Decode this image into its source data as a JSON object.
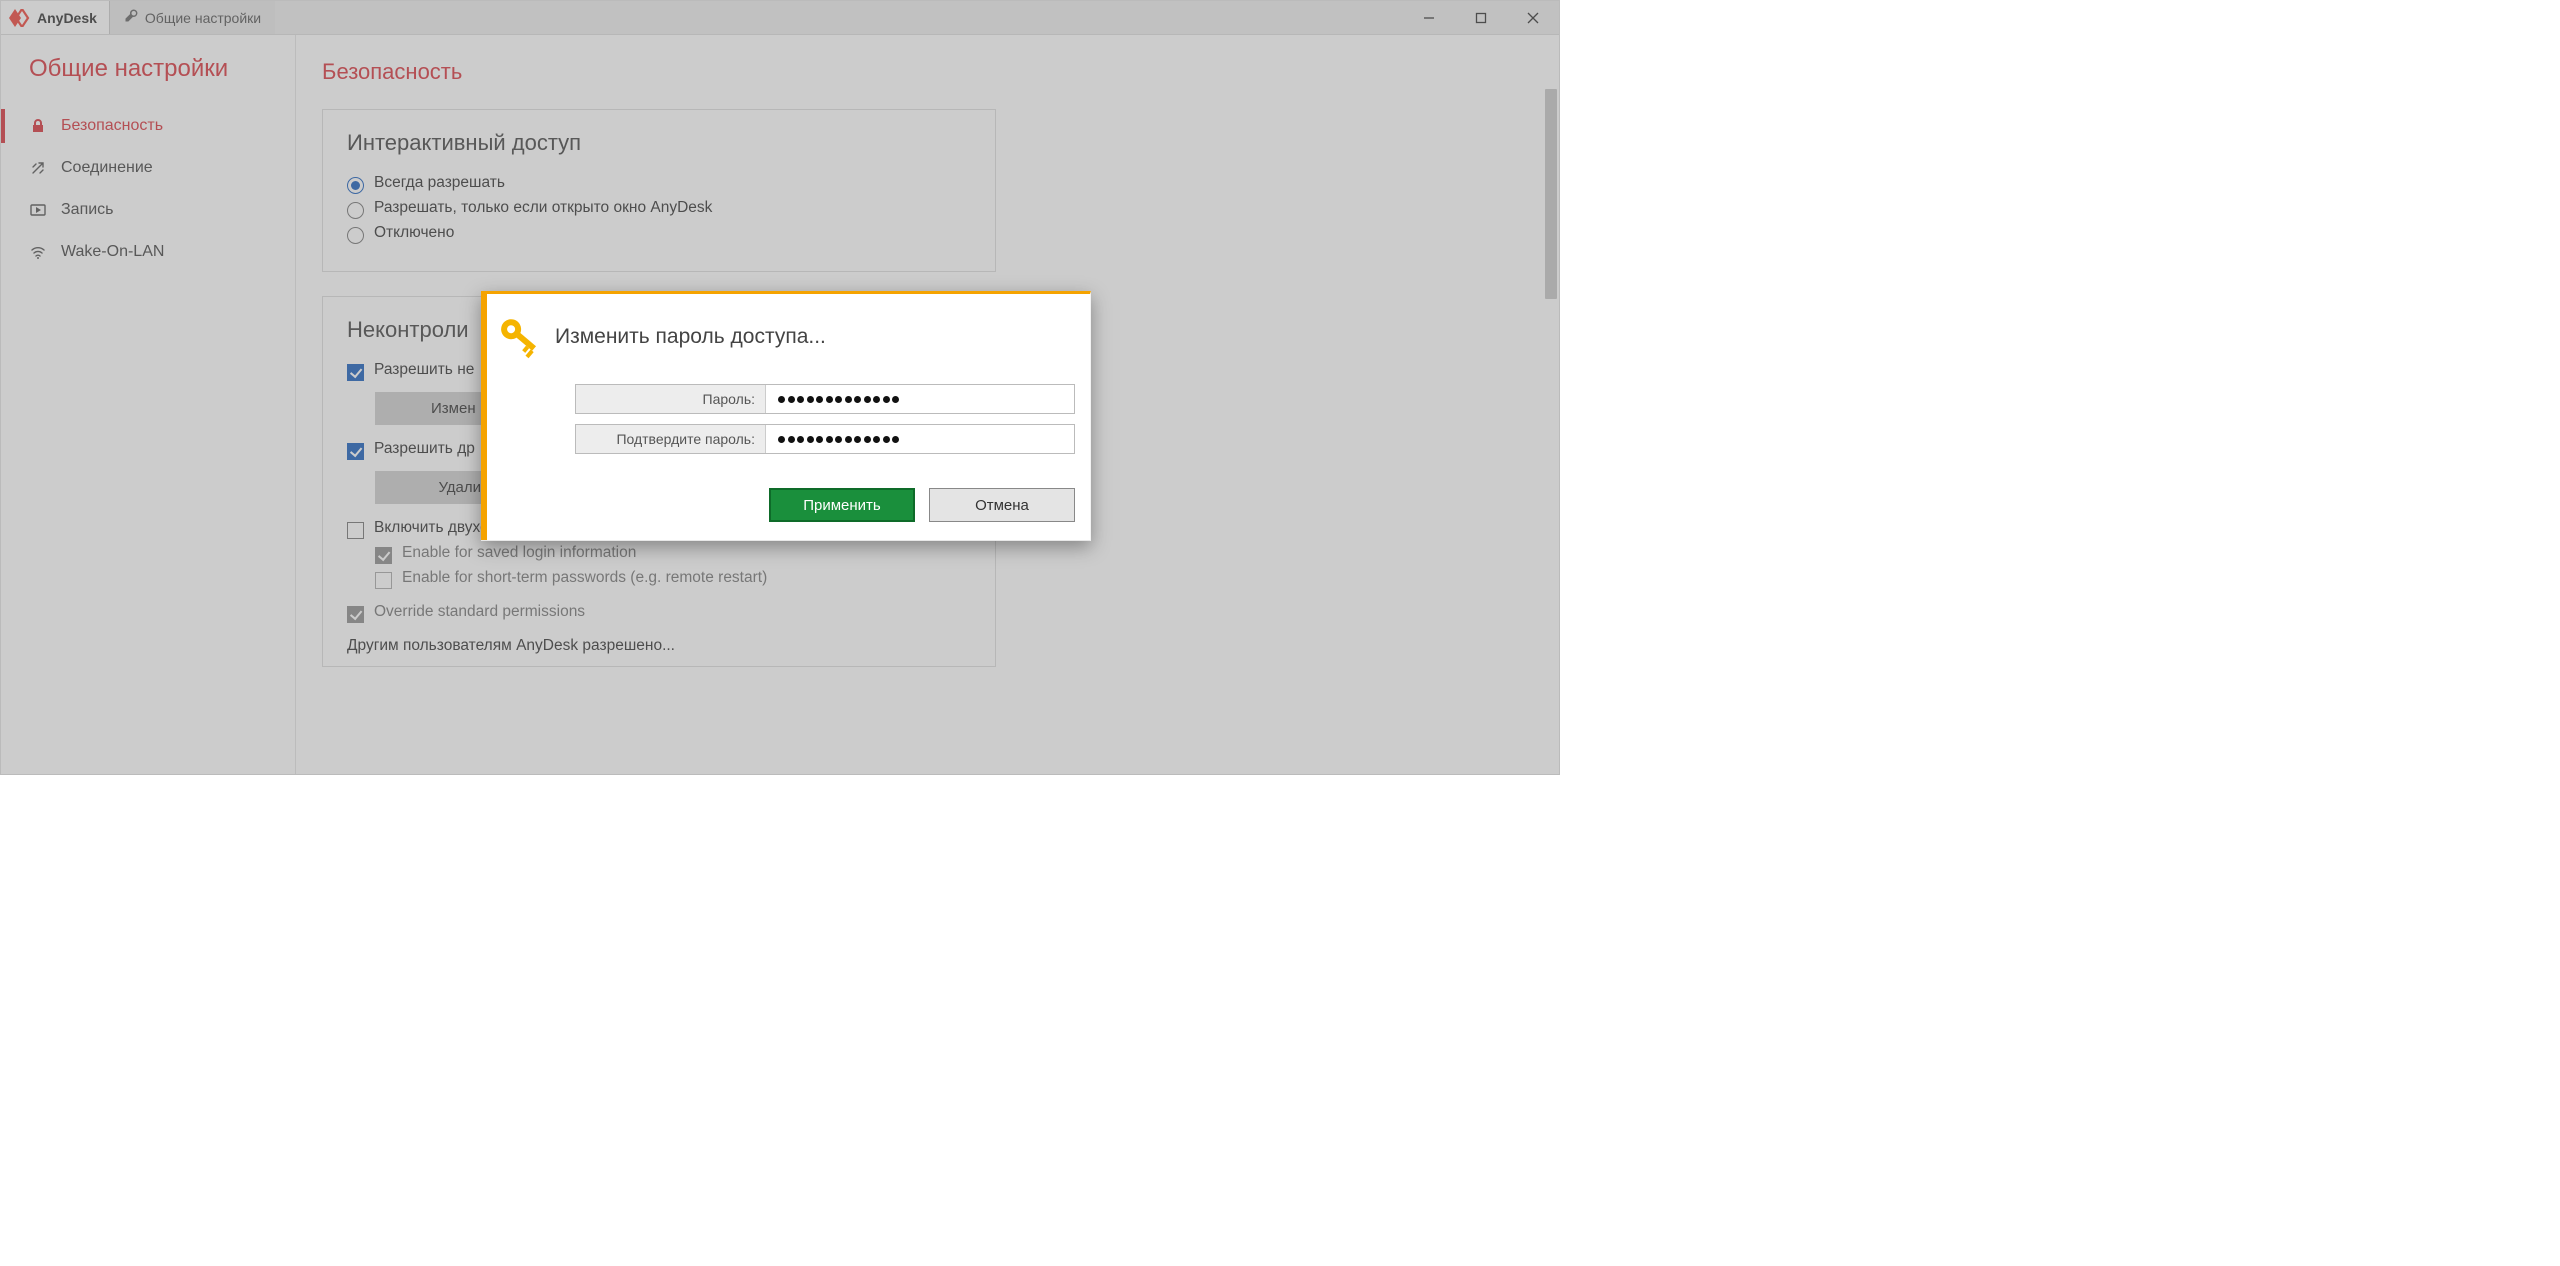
{
  "titlebar": {
    "app_name": "AnyDesk",
    "settings_tab": "Общие настройки"
  },
  "sidebar": {
    "title": "Общие настройки",
    "items": [
      {
        "label": "Безопасность",
        "icon": "lock-icon",
        "active": true
      },
      {
        "label": "Соединение",
        "icon": "connection-icon"
      },
      {
        "label": "Запись",
        "icon": "record-icon"
      },
      {
        "label": "Wake-On-LAN",
        "icon": "wifi-icon"
      }
    ]
  },
  "main": {
    "heading": "Безопасность",
    "interactive_access": {
      "title": "Интерактивный доступ",
      "options": [
        "Всегда разрешать",
        "Разрешать, только если открыто окно AnyDesk",
        "Отключено"
      ],
      "selected_index": 0
    },
    "unattended_access": {
      "title": "Неконтроли",
      "allow_unattended_label": "Разрешить не",
      "change_password_btn": "Измен",
      "allow_other_label": "Разрешить др",
      "delete_tokens_btn": "Удалить токены авторизации",
      "enable_2fa_label": "Включить двухфакторную аутентификацию",
      "enable_saved_login_label": "Enable for saved login information",
      "enable_short_term_label": "Enable for short-term passwords (e.g. remote restart)",
      "override_label": "Override standard permissions",
      "others_allowed_label": "Другим пользователям AnyDesk разрешено..."
    }
  },
  "dialog": {
    "title": "Изменить пароль доступа...",
    "password_label": "Пароль:",
    "confirm_label": "Подтвердите пароль:",
    "password_value": "•••••••••••••",
    "confirm_value": "•••••••••••••",
    "password_dot_count": 13,
    "apply_btn": "Применить",
    "cancel_btn": "Отмена"
  },
  "colors": {
    "accent_red": "#d9363e",
    "accent_orange": "#f5a300",
    "primary_green": "#1a8f3c"
  }
}
